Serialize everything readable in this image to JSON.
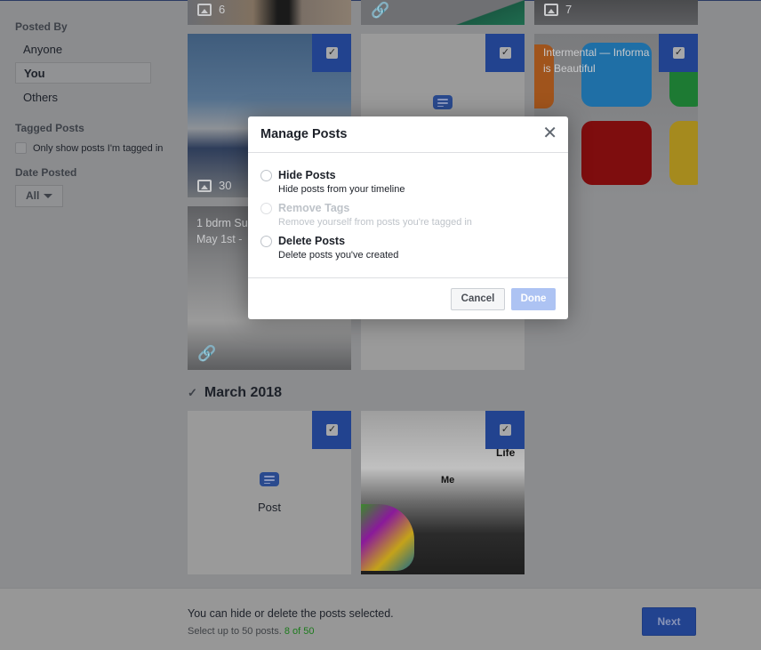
{
  "sidebar": {
    "posted_by": {
      "title": "Posted By",
      "options": [
        {
          "label": "Anyone",
          "selected": false
        },
        {
          "label": "You",
          "selected": true
        },
        {
          "label": "Others",
          "selected": false
        }
      ]
    },
    "tagged_posts": {
      "title": "Tagged Posts",
      "checkbox_label": "Only show posts I'm tagged in",
      "checked": false
    },
    "date_posted": {
      "title": "Date Posted",
      "selected": "All"
    }
  },
  "grid": {
    "top_row": [
      {
        "type": "photo",
        "count": "6"
      },
      {
        "type": "link"
      },
      {
        "type": "photo",
        "count": "7"
      }
    ],
    "row2": [
      {
        "type": "photo",
        "count": "30",
        "selected": true
      },
      {
        "type": "post",
        "selected": true
      },
      {
        "type": "link",
        "caption_line1": "Intermental — Informa",
        "caption_line2": "is Beautiful",
        "selected": true
      }
    ],
    "row3": [
      {
        "type": "link",
        "caption_line1": "1 bdrm Su",
        "caption_line2": "May 1st -"
      },
      {
        "type": "post"
      }
    ],
    "month_section": {
      "label": "March 2018",
      "checked": true,
      "tiles": [
        {
          "type": "post",
          "label": "Post",
          "selected": true
        },
        {
          "type": "photo",
          "text_me": "Me",
          "text_life": "Life",
          "selected": true
        }
      ]
    }
  },
  "bottom_bar": {
    "message": "You can hide or delete the posts selected.",
    "limit_text": "Select up to 50 posts.",
    "count_text": "8 of 50",
    "next_label": "Next"
  },
  "modal": {
    "title": "Manage Posts",
    "options": [
      {
        "label": "Hide Posts",
        "description": "Hide posts from your timeline",
        "disabled": false
      },
      {
        "label": "Remove Tags",
        "description": "Remove yourself from posts you're tagged in",
        "disabled": true
      },
      {
        "label": "Delete Posts",
        "description": "Delete posts you've created",
        "disabled": false
      }
    ],
    "cancel_label": "Cancel",
    "done_label": "Done"
  },
  "colors": {
    "accent": "#22438f",
    "count_green": "#1c7a1c",
    "done_disabled": "#adc3f3"
  }
}
